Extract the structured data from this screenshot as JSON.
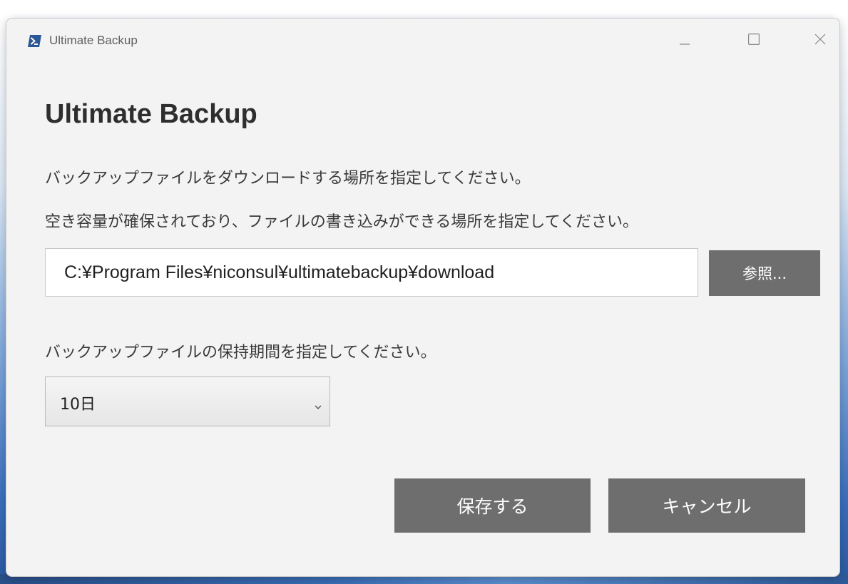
{
  "window": {
    "title": "Ultimate Backup"
  },
  "main": {
    "heading": "Ultimate Backup",
    "instruction_location_1": "バックアップファイルをダウンロードする場所を指定してください。",
    "instruction_location_2": "空き容量が確保されており、ファイルの書き込みができる場所を指定してください。",
    "download_path": "C:¥Program Files¥niconsul¥ultimatebackup¥download",
    "browse_label": "参照...",
    "instruction_retention": "バックアップファイルの保持期間を指定してください。",
    "retention_selected": "10日"
  },
  "footer": {
    "save_label": "保存する",
    "cancel_label": "キャンセル"
  },
  "colors": {
    "window_bg": "#f3f3f3",
    "button_bg": "#6e6e6e",
    "button_text": "#ffffff",
    "app_icon_blue": "#2b5797"
  },
  "icons": {
    "app": "powershell-icon",
    "minimize": "minimize-icon",
    "maximize": "maximize-icon",
    "close": "close-icon",
    "dropdown": "chevron-down-icon"
  }
}
